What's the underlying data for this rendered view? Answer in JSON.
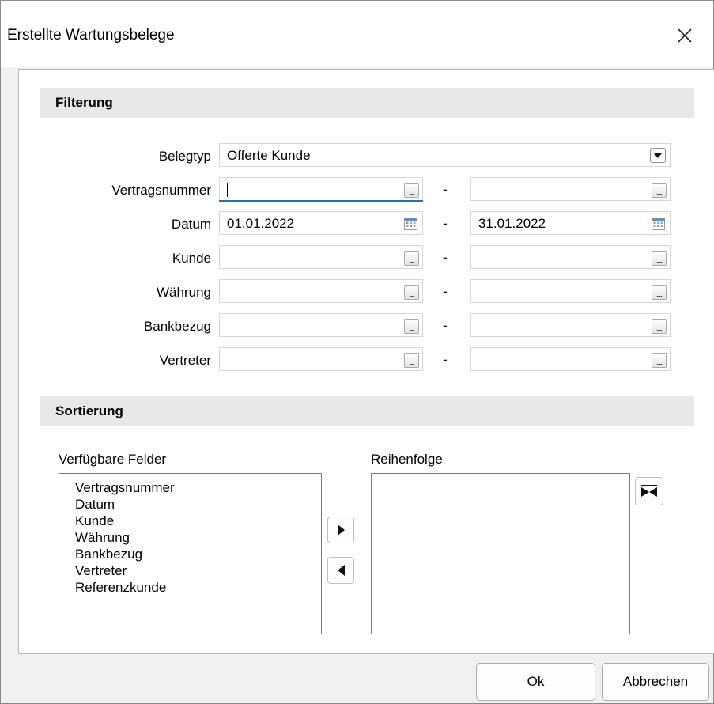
{
  "dialog": {
    "title": "Erstellte Wartungsbelege"
  },
  "filter": {
    "header": "Filterung",
    "belegtyp": {
      "label": "Belegtyp",
      "value": "Offerte Kunde"
    },
    "vertragsnummer": {
      "label": "Vertragsnummer",
      "from": "",
      "to": ""
    },
    "datum": {
      "label": "Datum",
      "from": "01.01.2022",
      "to": "31.01.2022"
    },
    "kunde": {
      "label": "Kunde",
      "from": "",
      "to": ""
    },
    "waehrung": {
      "label": "Währung",
      "from": "",
      "to": ""
    },
    "bankbezug": {
      "label": "Bankbezug",
      "from": "",
      "to": ""
    },
    "vertreter": {
      "label": "Vertreter",
      "from": "",
      "to": ""
    },
    "range_separator": "-",
    "lookup_button": "..."
  },
  "sort": {
    "header": "Sortierung",
    "available_label": "Verfügbare Felder",
    "order_label": "Reihenfolge",
    "available_fields": [
      "Vertragsnummer",
      "Datum",
      "Kunde",
      "Währung",
      "Bankbezug",
      "Vertreter",
      "Referenzkunde"
    ],
    "order_fields": []
  },
  "footer": {
    "ok": "Ok",
    "cancel": "Abbrechen"
  },
  "icons": {
    "close": "close-icon",
    "dropdown": "chevron-down-icon",
    "calendar": "calendar-icon",
    "add": "arrow-right-icon",
    "remove": "arrow-left-icon",
    "move": "sort-toggle-icon"
  }
}
